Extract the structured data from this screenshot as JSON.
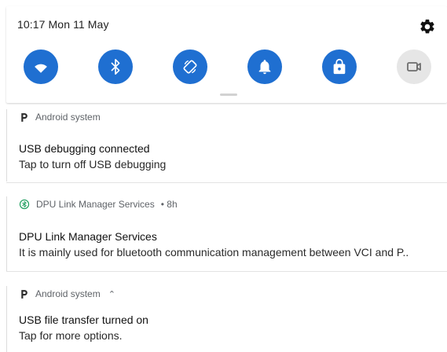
{
  "status_bar": {
    "time": "10:17",
    "date": "Mon 11 May"
  },
  "quick_settings": {
    "tiles": [
      {
        "icon": "wifi-icon",
        "active": true
      },
      {
        "icon": "bluetooth-icon",
        "active": true
      },
      {
        "icon": "auto-rotate-icon",
        "active": true
      },
      {
        "icon": "notification-bell-icon",
        "active": true
      },
      {
        "icon": "lock-icon",
        "active": true
      },
      {
        "icon": "screen-record-icon",
        "active": false
      }
    ]
  },
  "notifications": [
    {
      "app": "Android system",
      "title": "USB debugging connected",
      "body": "Tap to turn off USB debugging"
    },
    {
      "app": "DPU Link Manager Services",
      "time_suffix": "• 8h",
      "title": "DPU Link Manager Services",
      "body": "It is mainly used for bluetooth communication management between VCI and P.."
    },
    {
      "app": "Android system",
      "expand_glyph": "⌃",
      "title": "USB file transfer turned on",
      "body": "Tap for more options."
    }
  ],
  "colors": {
    "tile_active": "#1f6fd1",
    "tile_inactive": "#e6e6e6"
  }
}
